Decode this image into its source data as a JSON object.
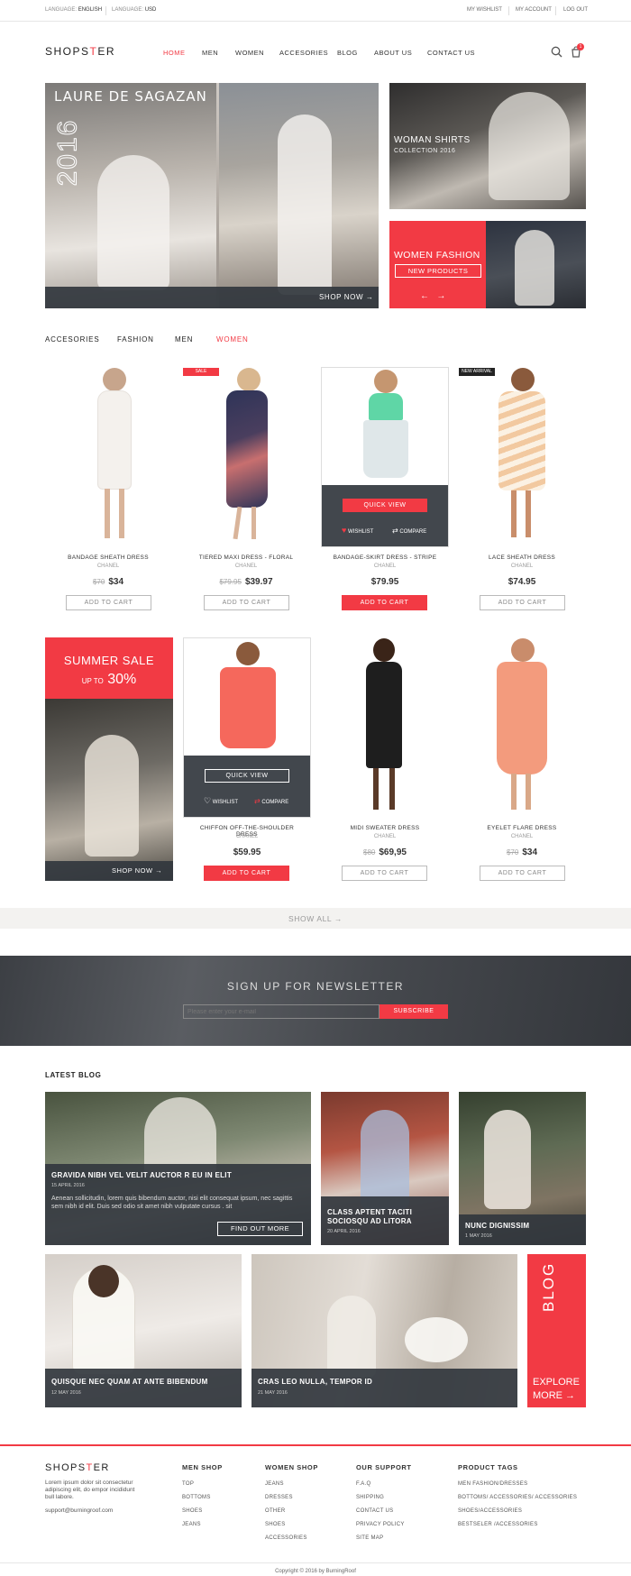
{
  "topbar": {
    "language_label": "LANGUAGE:",
    "language_value": "ENGLISH",
    "currency_label": "LANGUAGE:",
    "currency_value": "USD",
    "links": [
      "MY WISHLIST",
      "MY ACCOUNT",
      "LOG OUT"
    ]
  },
  "header": {
    "logo_left": "SHOPS",
    "logo_mark": "T",
    "logo_right": "ER",
    "nav": [
      "HOME",
      "MEN",
      "WOMEN",
      "ACCESORIES",
      "BLOG",
      "ABOUT US",
      "CONTACT US"
    ],
    "active_nav": "HOME",
    "cart_count": "1"
  },
  "hero": {
    "main_title": "LAURE DE SAGAZAN",
    "main_year": "2016",
    "shop_now": "SHOP NOW →",
    "shirts_title": "WOMAN SHIRTS",
    "shirts_subtitle": "COLLECTION 2016",
    "fashion_title": "WOMEN FASHION",
    "fashion_button": "NEW PRODUCTS",
    "arrows": "←   →"
  },
  "category_tabs": [
    "ACCESORIES",
    "FASHION",
    "MEN",
    "WOMEN"
  ],
  "active_tab": "WOMEN",
  "products_row1": [
    {
      "name": "BANDAGE SHEATH DRESS",
      "brand": "CHANEL",
      "old_price": "$70",
      "price": "$34",
      "cart": "ADD TO CART",
      "badge": ""
    },
    {
      "name": "TIERED MAXI DRESS - FLORAL",
      "brand": "CHANEL",
      "old_price": "$79.95",
      "price": "$39.97",
      "cart": "ADD TO CART",
      "badge": "SALE"
    },
    {
      "name": "BANDAGE-SKIRT DRESS - STRIPE",
      "brand": "CHANEL",
      "old_price": "",
      "price": "$79.95",
      "cart": "ADD TO CART",
      "badge": ""
    },
    {
      "name": "LACE SHEATH DRESS",
      "brand": "CHANEL",
      "old_price": "",
      "price": "$74.95",
      "cart": "ADD TO CART",
      "badge": "NEW ARRIVAL"
    }
  ],
  "quick_view": {
    "label": "QUICK VIEW",
    "wishlist": "WISHLIST",
    "compare": "COMPARE"
  },
  "summer_sale": {
    "title": "SUMMER SALE",
    "up_to": "UP TO",
    "percent": "30%",
    "shop_now": "SHOP NOW →"
  },
  "products_row2": [
    {
      "name": "CHIFFON OFF-THE-SHOULDER DRESS",
      "brand": "CHANEL",
      "old_price": "",
      "price": "$59.95",
      "cart": "ADD TO CART"
    },
    {
      "name": "MIDI SWEATER DRESS",
      "brand": "CHANEL",
      "old_price": "$80",
      "price": "$69,95",
      "cart": "ADD TO CART"
    },
    {
      "name": "EYELET FLARE DRESS",
      "brand": "CHANEL",
      "old_price": "$70",
      "price": "$34",
      "cart": "ADD TO CART"
    }
  ],
  "show_all": "SHOW ALL →",
  "newsletter": {
    "title": "SIGN UP FOR NEWSLETTER",
    "placeholder": "Please enter your e-mail",
    "button": "SUBSCRIBE"
  },
  "blog": {
    "section_title": "LATEST BLOG",
    "posts": [
      {
        "title": "GRAVIDA NIBH VEL VELIT AUCTOR R EU IN ELIT",
        "date": "15 APRIL 2016",
        "excerpt": "Aenean sollicitudin, lorem quis bibendum auctor, nisi elit consequat ipsum, nec sagittis sem nibh id elit. Duis sed odio sit amet nibh vulputate cursus . sit",
        "button": "FIND OUT MORE"
      },
      {
        "title": "CLASS APTENT TACITI SOCIOSQU AD LITORA",
        "date": "20 APRIL 2016"
      },
      {
        "title": "NUNC DIGNISSIM",
        "date": "1 MAY 2016"
      },
      {
        "title": "QUISQUE NEC QUAM AT ANTE BIBENDUM",
        "date": "12 MAY 2016"
      },
      {
        "title": "CRAS LEO NULLA, TEMPOR ID",
        "date": "21 MAY 2016"
      }
    ],
    "side_label": "BLOG",
    "explore": "EXPLORE",
    "more": "MORE →"
  },
  "footer": {
    "about": "Lorem ipsum dolor sit consectetur adipiscing elit, do empor incididunt bull labore.",
    "email": "support@burningroof.com",
    "columns": [
      {
        "title": "MEN SHOP",
        "links": [
          "TOP",
          "BOTTOMS",
          "SHOES",
          "JEANS"
        ]
      },
      {
        "title": "WOMEN SHOP",
        "links": [
          "JEANS",
          "DRESSES",
          "OTHER",
          "SHOES",
          "ACCESSORIES"
        ]
      },
      {
        "title": "OUR SUPPORT",
        "links": [
          "F.A.Q",
          "SHIPPING",
          "CONTACT US",
          "PRIVACY POLICY",
          "SITE MAP"
        ]
      },
      {
        "title": "PRODUCT TAGS",
        "links": [
          "MEN FASHION/DRESSES",
          "BOTTOMS/ ACCESSORIES/ ACCESSORIES",
          "SHOES/ACCESSORIES",
          "BESTSELER /ACCESSORIES"
        ]
      }
    ],
    "copyright": "Copyright © 2016 by BurningRoof"
  },
  "colors": {
    "accent": "#f23a44",
    "dark": "#343a42"
  }
}
